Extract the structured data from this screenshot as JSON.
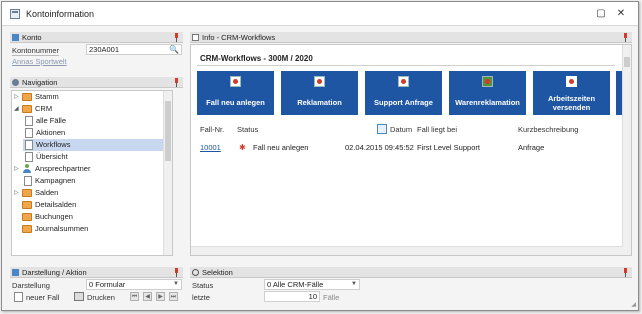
{
  "window": {
    "title": "Kontoinformation",
    "minimize": "▢",
    "close": "✕"
  },
  "konto": {
    "header": "Konto",
    "label": "Kontonummer",
    "value": "230A001",
    "sublabel": "Annas Sportwelt"
  },
  "navigation": {
    "header": "Navigation",
    "items": [
      {
        "label": "Stamm"
      },
      {
        "label": "CRM"
      },
      {
        "label": "alle Fälle"
      },
      {
        "label": "Aktionen"
      },
      {
        "label": "Workflows"
      },
      {
        "label": "Übersicht"
      },
      {
        "label": "Ansprechpartner"
      },
      {
        "label": "Kampagnen"
      },
      {
        "label": "Salden"
      },
      {
        "label": "Detailsalden"
      },
      {
        "label": "Buchungen"
      },
      {
        "label": "Journalsummen"
      }
    ]
  },
  "info": {
    "header": "Info - CRM-Workflows",
    "title": "CRM-Workflows - 300M / 2020",
    "tiles": [
      {
        "label": "Fall neu anlegen"
      },
      {
        "label": "Reklamation"
      },
      {
        "label": "Support Anfrage"
      },
      {
        "label": "Warenreklamation"
      },
      {
        "label": "Arbeitszeiten versenden"
      }
    ],
    "columns": [
      "Fall-Nr.",
      "Status",
      "Datum",
      "Fall liegt bei",
      "Kurzbeschreibung"
    ],
    "rows": [
      {
        "nr": "10001",
        "status": "Fall neu anlegen",
        "datum": "02.04.2015 09:45:52",
        "liegt_bei": "First Level Support",
        "kurz": "Anfrage"
      }
    ]
  },
  "darstellung": {
    "header": "Darstellung / Aktion",
    "label": "Darstellung",
    "value": "0 Formular",
    "new_label": "neuer Fall",
    "print_label": "Drucken"
  },
  "selektion": {
    "header": "Selektion",
    "status_label": "Status",
    "status_value": "0 Alle CRM-Fälle",
    "letzte_label": "letzte",
    "letzte_value": "10",
    "letzte_unit": "Fälle"
  },
  "colors": {
    "accent": "#1f56a3",
    "selected": "#c7d7ef",
    "pin": "#d23a2a"
  }
}
